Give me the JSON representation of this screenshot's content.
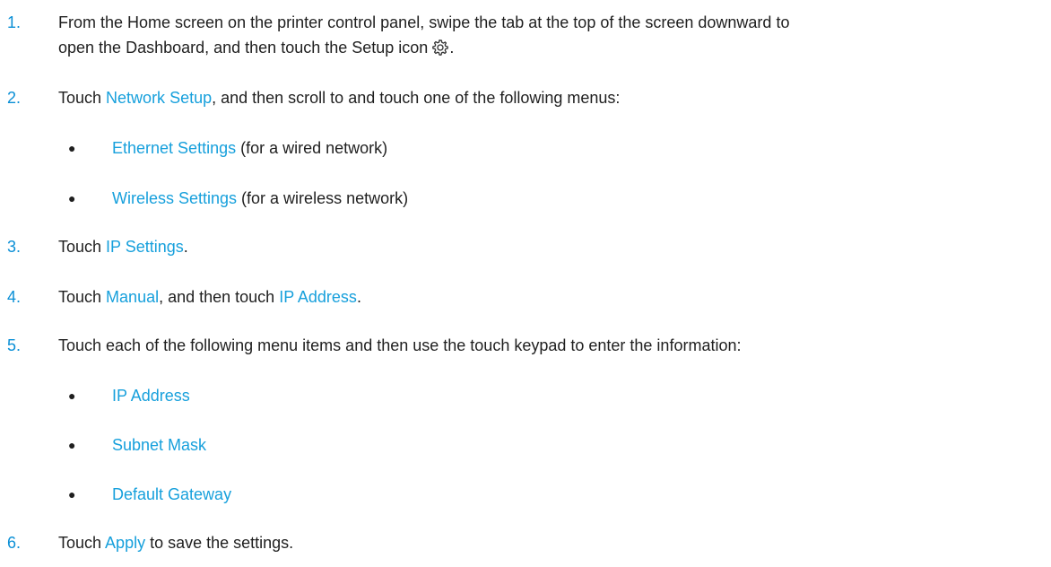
{
  "steps": [
    {
      "number": "1.",
      "line1": "From the Home screen on the printer control panel, swipe the tab at the top of the screen downward to",
      "line2_before": "open the Dashboard, and then touch the Setup icon",
      "line2_after": "."
    },
    {
      "number": "2.",
      "t1": "Touch ",
      "ui1": "Network Setup",
      "t2": ", and then scroll to and touch one of the following menus:",
      "bullets": [
        {
          "ui": "Ethernet Settings",
          "rest": " (for a wired network)"
        },
        {
          "ui": "Wireless Settings",
          "rest": " (for a wireless network)"
        }
      ]
    },
    {
      "number": "3.",
      "t1": "Touch ",
      "ui1": "IP Settings",
      "t2": "."
    },
    {
      "number": "4.",
      "t1": "Touch ",
      "ui1": "Manual",
      "t2": ", and then touch ",
      "ui2": "IP Address",
      "t3": "."
    },
    {
      "number": "5.",
      "t1": "Touch each of the following menu items and then use the touch keypad to enter the information:",
      "bullets": [
        {
          "ui": "IP Address"
        },
        {
          "ui": "Subnet Mask"
        },
        {
          "ui": "Default Gateway"
        }
      ]
    },
    {
      "number": "6.",
      "t1": "Touch ",
      "ui1": "Apply",
      "t2": " to save the settings."
    }
  ],
  "bullet_glyph": "●",
  "icons": {
    "setup": "gear-icon"
  },
  "colors": {
    "step_number": "#0a8fd6",
    "ui_term": "#17a0dc",
    "text": "#1f1f1f"
  }
}
